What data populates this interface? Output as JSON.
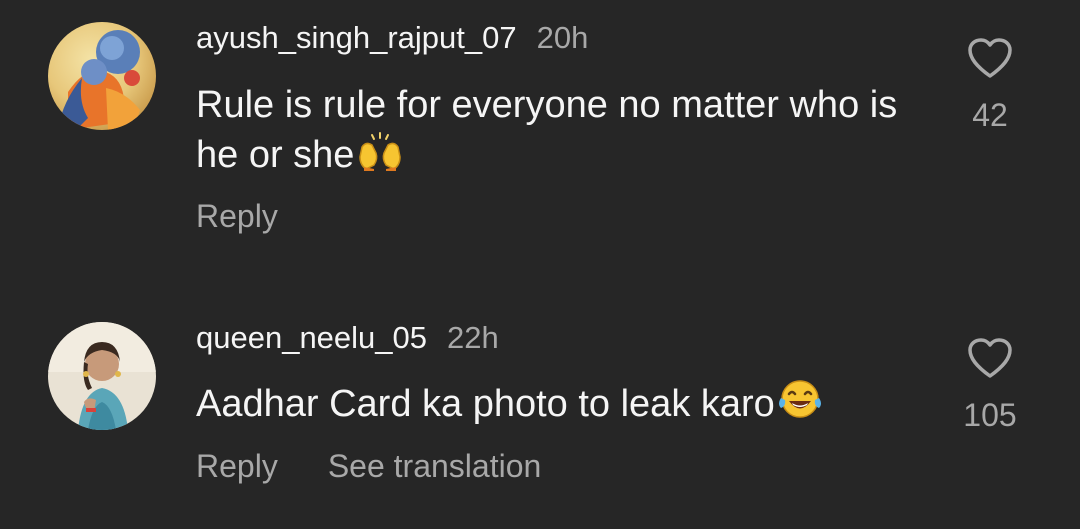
{
  "comments": [
    {
      "username": "ayush_singh_rajput_07",
      "time": "20h",
      "text": "Rule is rule for everyone no matter who is he or she",
      "text_emoji": "raising-hands",
      "like_count": "42",
      "reply_label": "Reply"
    },
    {
      "username": "queen_neelu_05",
      "time": "22h",
      "text": "Aadhar Card ka photo to leak karo",
      "text_emoji": "laughing-tears",
      "like_count": "105",
      "reply_label": "Reply",
      "translation_label": "See translation"
    }
  ],
  "colors": {
    "background": "#262626",
    "primary_text": "#f5f5f5",
    "secondary_text": "#a8a8a8"
  }
}
